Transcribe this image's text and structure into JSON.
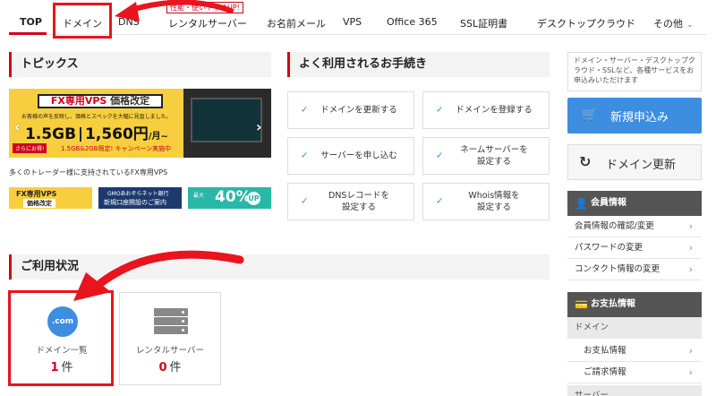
{
  "nav": {
    "items": [
      {
        "name": "nav-top",
        "label": "TOP"
      },
      {
        "name": "nav-domain",
        "label": "ドメイン"
      },
      {
        "name": "nav-dns",
        "label": "DNS"
      },
      {
        "name": "nav-rental-server",
        "label": "レンタルサーバー"
      },
      {
        "name": "nav-onamae-mail",
        "label": "お名前メール"
      },
      {
        "name": "nav-vps",
        "label": "VPS"
      },
      {
        "name": "nav-office365",
        "label": "Office 365"
      },
      {
        "name": "nav-ssl",
        "label": "SSL証明書"
      },
      {
        "name": "nav-desktop-cloud",
        "label": "デスクトップクラウド"
      },
      {
        "name": "nav-other",
        "label": "その他"
      }
    ],
    "badge": "性能・使いやすさUP!"
  },
  "topics": {
    "title": "トピックス",
    "banner": {
      "fx_label": "FX専用VPS",
      "fx_tag": "価格改定",
      "sub": "お客様の声を反映し、価格とスペックを大幅に見直しました。",
      "capacity": "1.5GB",
      "price": "1,560円",
      "per": "/月~",
      "red_tag": "さらにお得!",
      "red_text": "1.5GB&2GB限定! キャンペーン実施中"
    },
    "caption": "多くのトレーダー様に支持されているFX専用VPS",
    "mini_banners": [
      {
        "a": "FX専用VPS",
        "b": "価格改定"
      },
      {
        "a": "GMOあおぞらネット銀行",
        "b": "新規口座開設のご案内"
      },
      {
        "a": "最大",
        "b": "40%",
        "c": "UP"
      }
    ]
  },
  "procedures": {
    "title": "よく利用されるお手続き",
    "items": [
      "ドメインを更新する",
      "ドメインを登録する",
      "サーバーを申し込む",
      "ネームサーバーを\n設定する",
      "DNSレコードを\n設定する",
      "Whois情報を\n設定する"
    ]
  },
  "usage": {
    "title": "ご利用状況",
    "cards": [
      {
        "icon_text": ".com",
        "label": "ドメイン一覧",
        "count": "1",
        "unit": "件"
      },
      {
        "label": "レンタルサーバー",
        "count": "0",
        "unit": "件"
      }
    ]
  },
  "sidebar": {
    "description": "ドメイン・サーバー・デスクトップクラウド・SSLなど、各種サービスをお申込みいただけます",
    "new_button": "新規申込み",
    "renew_button": "ドメイン更新",
    "member_head": "会員情報",
    "member_links": [
      "会員情報の確認/変更",
      "パスワードの変更",
      "コンタクト情報の変更"
    ],
    "payment_head": "お支払情報",
    "payment_domain": "ドメイン",
    "payment_links": [
      "お支払情報",
      "ご請求情報"
    ],
    "payment_server": "サーバー"
  },
  "colors": {
    "accent": "#d0021b",
    "primary_blue": "#3d8ee0",
    "annotation_red": "#e8141e"
  }
}
